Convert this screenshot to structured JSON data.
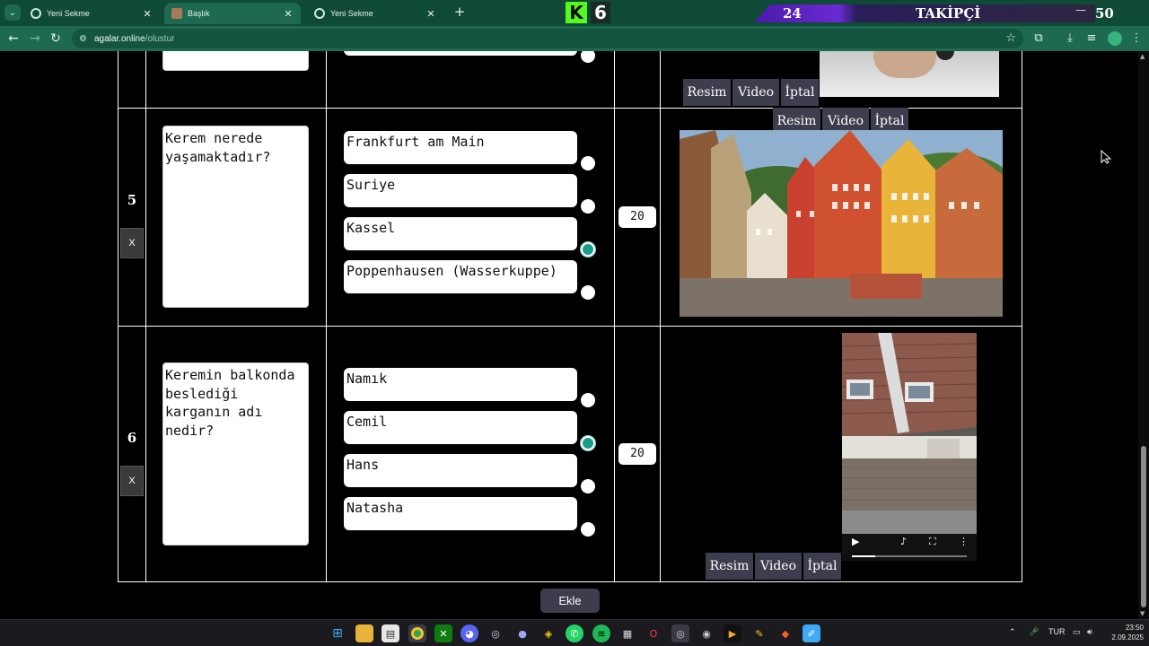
{
  "browser": {
    "tabs": [
      {
        "label": "Yeni Sekme",
        "close": "✕"
      },
      {
        "label": "Başlık",
        "close": "✕"
      },
      {
        "label": "Yeni Sekme",
        "close": "✕"
      }
    ],
    "new_tab": "+",
    "url_host": "agalar.online",
    "url_path": "/olustur"
  },
  "overlay": {
    "kick_letter": "K",
    "kick_number": "6",
    "followers_current": "24",
    "followers_label": "TAKİPÇİ",
    "followers_goal": "50"
  },
  "media_buttons": {
    "image": "Resim",
    "video": "Video",
    "cancel": "İptal"
  },
  "questions": [
    {
      "number": "5",
      "delete": "X",
      "text": "Kerem nerede\nyaşamaktadır?",
      "answers": [
        "Frankfurt am Main",
        "Suriye",
        "Kassel",
        "Poppenhausen (Wasserkuppe)"
      ],
      "correct_index": 2,
      "points": "20"
    },
    {
      "number": "6",
      "delete": "X",
      "text": "Keremin balkonda\nbeslediği\nkarganın adı\nnedir?",
      "answers": [
        "Namık",
        "Cemil",
        "Hans",
        "Natasha"
      ],
      "correct_index": 1,
      "points": "20"
    }
  ],
  "add_button": "Ekle",
  "video_progress": 0.2,
  "taskbar": {
    "language": "TUR",
    "time": "23:50",
    "date": "2.09.2025"
  }
}
